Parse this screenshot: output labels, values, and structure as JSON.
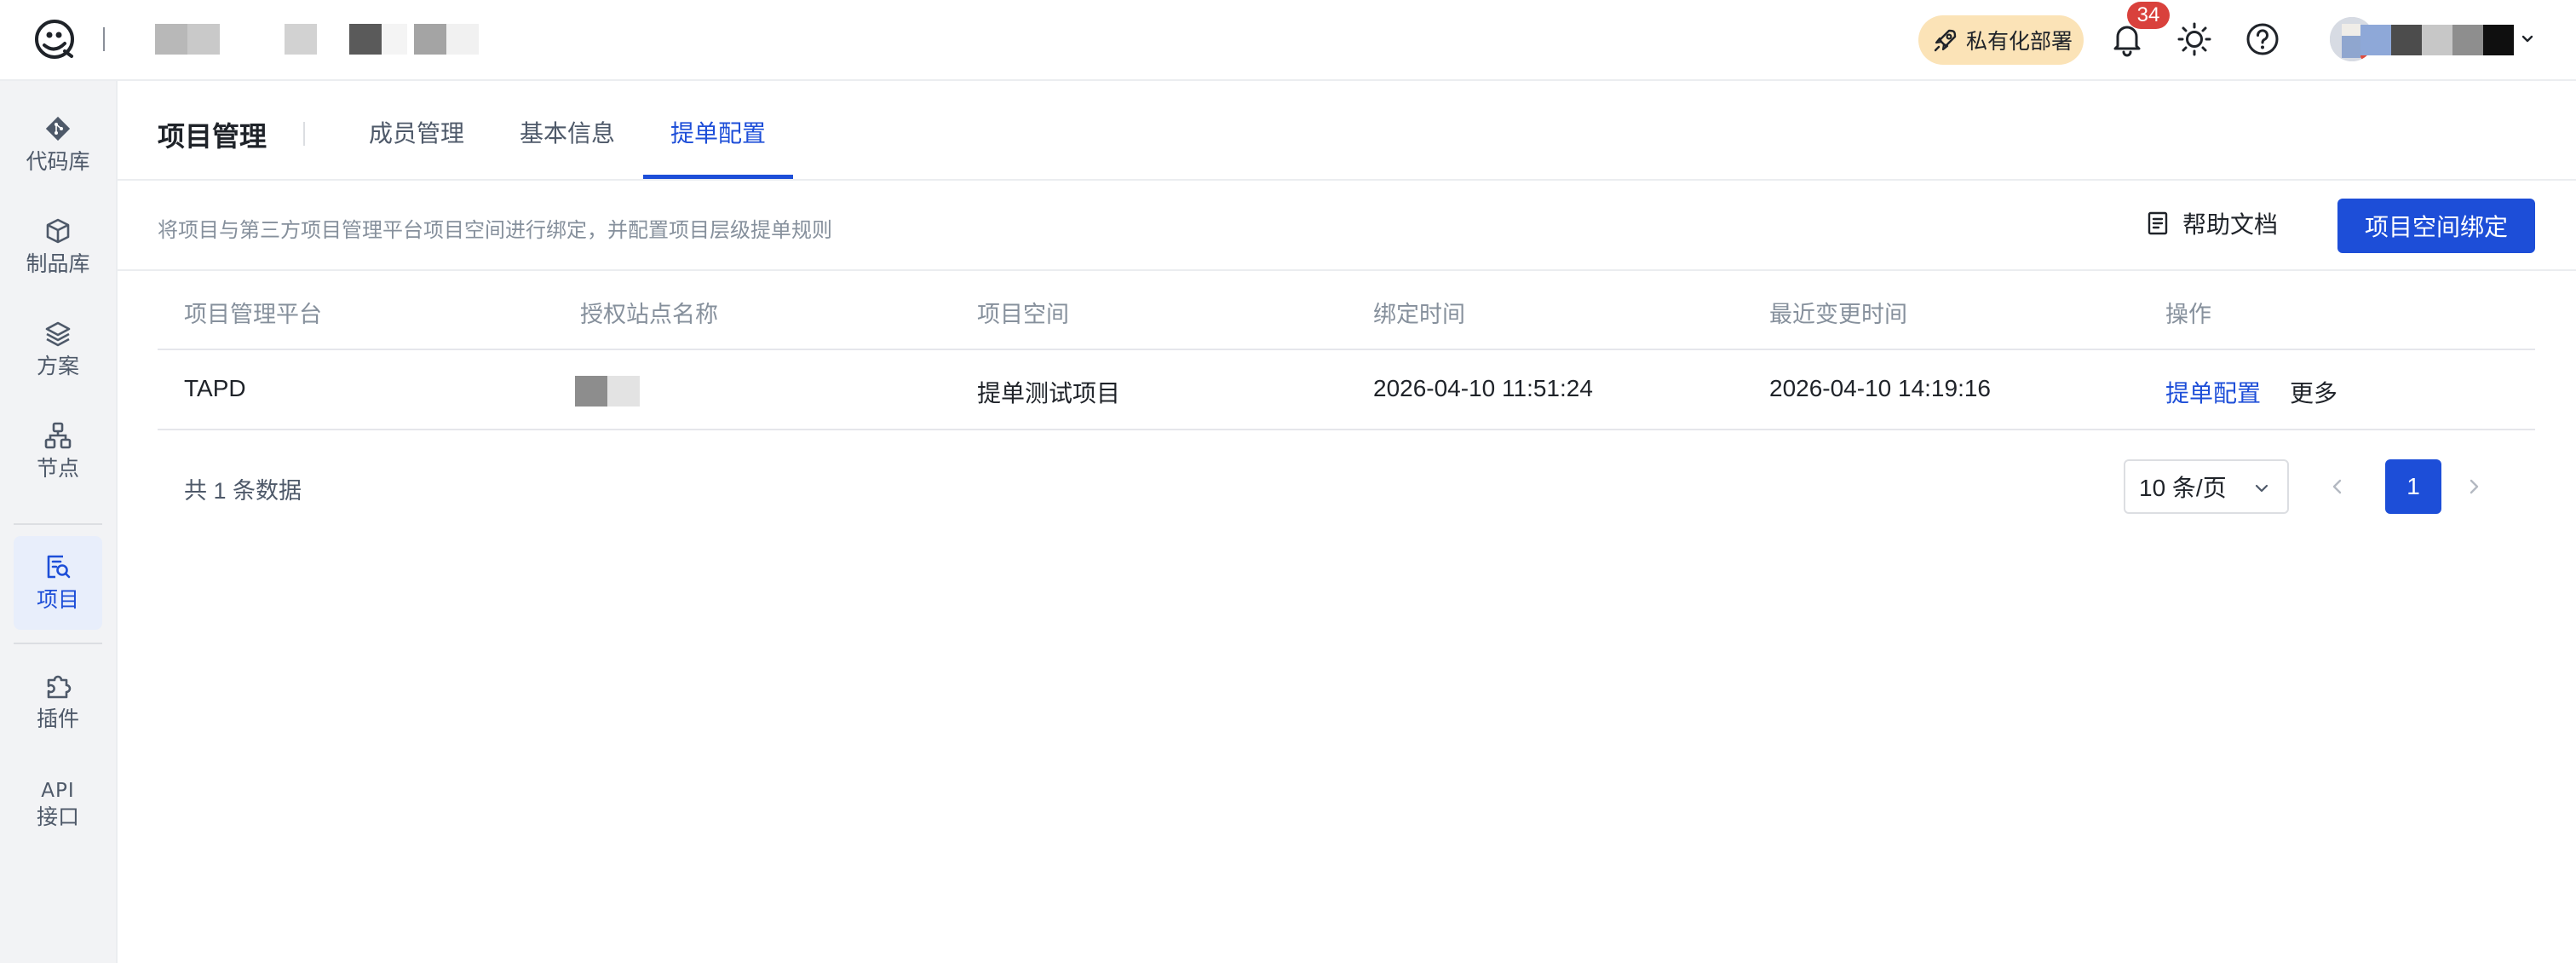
{
  "topbar": {
    "promo_label": "私有化部署",
    "notification_count": "34"
  },
  "sidebar": {
    "items": [
      {
        "label": "代码库",
        "icon": "git-icon"
      },
      {
        "label": "制品库",
        "icon": "package-icon"
      },
      {
        "label": "方案",
        "icon": "layers-icon"
      },
      {
        "label": "节点",
        "icon": "nodes-icon"
      },
      {
        "label": "项目",
        "icon": "project-icon",
        "active": true
      },
      {
        "label": "插件",
        "icon": "puzzle-icon"
      },
      {
        "label_top": "API",
        "label": "接口"
      }
    ]
  },
  "header": {
    "title": "项目管理",
    "tabs": [
      {
        "label": "成员管理"
      },
      {
        "label": "基本信息"
      },
      {
        "label": "提单配置",
        "active": true
      }
    ]
  },
  "toolbar": {
    "description": "将项目与第三方项目管理平台项目空间进行绑定，并配置项目层级提单规则",
    "help_label": "帮助文档",
    "bind_label": "项目空间绑定"
  },
  "table": {
    "columns": [
      "项目管理平台",
      "授权站点名称",
      "项目空间",
      "绑定时间",
      "最近变更时间",
      "操作"
    ],
    "rows": [
      {
        "platform": "TAPD",
        "space": "提单测试项目",
        "bound_at": "2026-04-10 11:51:24",
        "changed_at": "2026-04-10 14:19:16",
        "action_config": "提单配置",
        "action_more": "更多"
      }
    ]
  },
  "pagination": {
    "total_text": "共 1 条数据",
    "page_size": "10 条/页",
    "current_page": "1"
  },
  "colors": {
    "accent": "#1d4ed8",
    "badge": "#d9413c",
    "promo_bg": "#fbe3b7"
  }
}
